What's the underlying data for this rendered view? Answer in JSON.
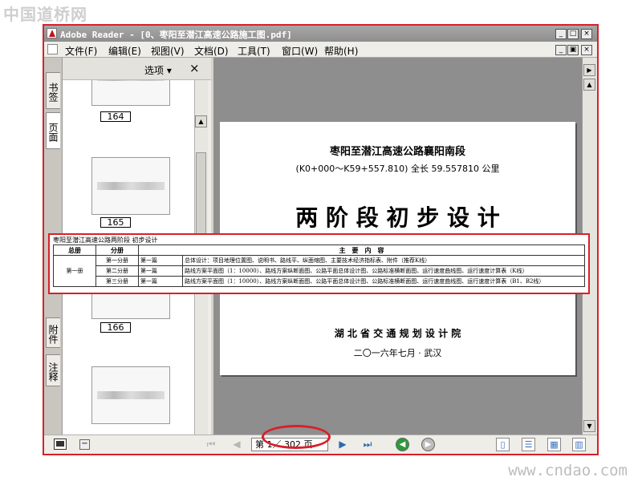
{
  "watermarks": {
    "top": "中国道桥网",
    "bottom": "www.cndao.com"
  },
  "window": {
    "title": "Adobe Reader - [0、枣阳至潜江高速公路施工图.pdf]",
    "controls": {
      "minimize": "_",
      "maximize": "□",
      "close": "×",
      "restore": "🗗"
    }
  },
  "menu": [
    "文件(F)",
    "编辑(E)",
    "视图(V)",
    "文档(D)",
    "工具(T)",
    "窗口(W)",
    "帮助(H)"
  ],
  "side_tabs": [
    "书签",
    "页面",
    "附件",
    "注释"
  ],
  "thumbnails": {
    "options_label": "选项 ▾",
    "close_label": "×",
    "pages": [
      "164",
      "165",
      "166"
    ]
  },
  "document": {
    "line1": "枣阳至潜江高速公路襄阳南段",
    "line2": "(K0+000～K59+557.810) 全长 59.557810 公里",
    "line3": "两 阶 段 初 步 设 计",
    "org": "湖 北 省 交 通 规 划 设 计 院",
    "date": "二〇一六年七月 · 武汉"
  },
  "overlay_table": {
    "caption": "枣阳至潜江高速公路两阶段 初步设计",
    "headers": [
      "总册",
      "分册",
      "主　要　内　容"
    ],
    "group": "第一册",
    "rows": [
      {
        "sub": "第一分册",
        "part": "第一篇",
        "content": "总体设计：项目地理位置图、说明书、路线平、纵面缩图、主要技术经济指标表、附件（推荐K线）"
      },
      {
        "sub": "第二分册",
        "part": "第一篇",
        "content": "路线方案平面图（1：10000）、路线方案纵断面图、公路平面总体设计图、公路标准横断面图、运行速度曲线图、运行速度计算表（K线）"
      },
      {
        "sub": "第三分册",
        "part": "第一篇",
        "content": "路线方案平面图（1：10000）、路线方案纵断面图、公路平面总体设计图、公路标准横断面图、运行速度曲线图、运行速度计算表（B1、B2线）"
      }
    ]
  },
  "navigation": {
    "page_display": "第 1／ 302 页",
    "current_page": 1,
    "total_pages": 302
  }
}
